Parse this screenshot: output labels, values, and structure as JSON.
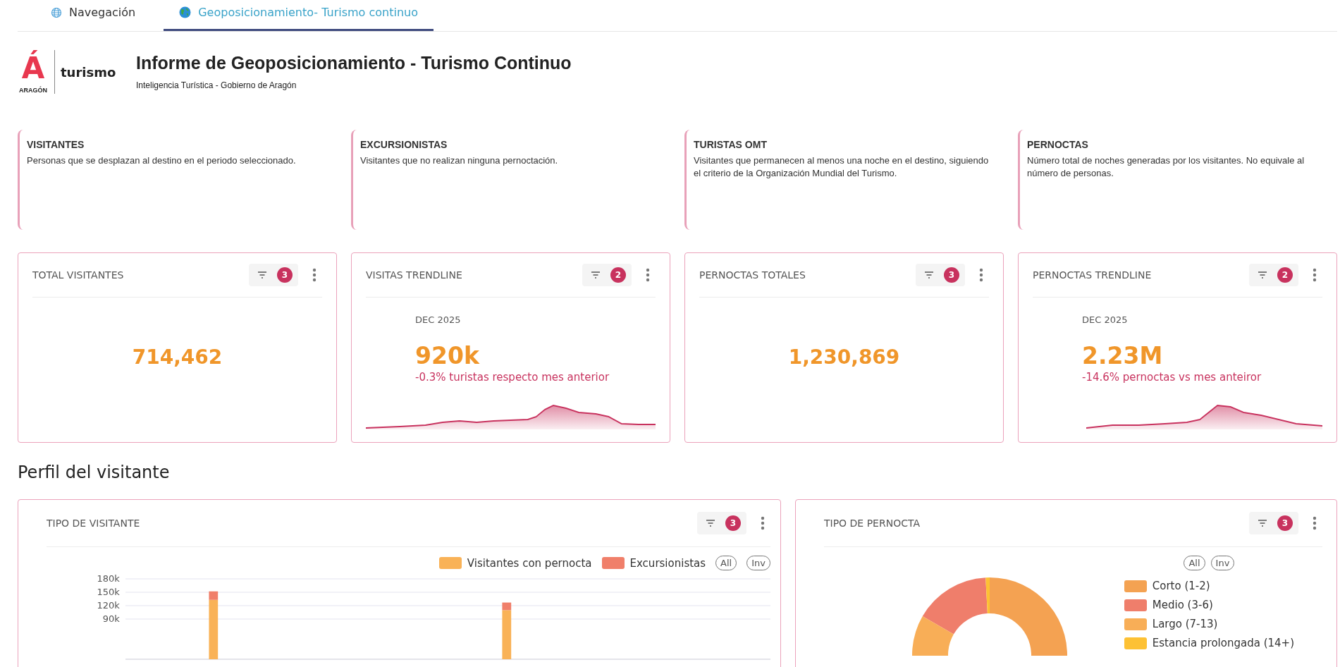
{
  "tabs": [
    {
      "label": "Navegación",
      "selected": false,
      "kind": "globe"
    },
    {
      "label": "Geoposicionamiento- Turismo continuo",
      "selected": true,
      "kind": "earth"
    }
  ],
  "logo": {
    "mark": "Á",
    "region": "ARAGÓN",
    "word": "turismo"
  },
  "header": {
    "title": "Informe de Geoposicionamiento - Turismo Continuo",
    "subtitle": "Inteligencia Turística - Gobierno de Aragón"
  },
  "definitions": [
    {
      "title": "VISITANTES",
      "text": "Personas que se desplazan al destino en el periodo seleccionado."
    },
    {
      "title": "EXCURSIONISTAS",
      "text": "Visitantes que no realizan ninguna pernoctación."
    },
    {
      "title": "TURISTAS OMT",
      "text": "Visitantes que permanecen al menos una noche en el destino, siguiendo el criterio de la Organización Mundial del Turismo."
    },
    {
      "title": "PERNOCTAS",
      "text": "Número total de noches generadas por los visitantes. No equivale al número de personas."
    }
  ],
  "kpis": [
    {
      "kind": "total",
      "title": "TOTAL VISITANTES",
      "filter_count": "3",
      "value": "714,462"
    },
    {
      "kind": "trend",
      "title": "VISITAS TRENDLINE",
      "filter_count": "2",
      "period": "DEC 2025",
      "value": "920k",
      "change": "-0.3% turistas respecto mes anterior"
    },
    {
      "kind": "total",
      "title": "PERNOCTAS TOTALES",
      "filter_count": "3",
      "value": "1,230,869"
    },
    {
      "kind": "trend",
      "title": "PERNOCTAS TRENDLINE",
      "filter_count": "2",
      "period": "DEC 2025",
      "value": "2.23M",
      "change": "-14.6% pernoctas vs mes anteiror"
    }
  ],
  "section_title": "Perfil del visitante",
  "panels": [
    {
      "kind": "bar",
      "title": "TIPO DE VISITANTE",
      "filter_count": "3",
      "toggles": [
        "All",
        "Inv"
      ],
      "chart_data": {
        "type": "bar",
        "stacked": true,
        "grid": true,
        "ylim": [
          0,
          180000
        ],
        "yticks": [
          {
            "value": 90000,
            "label": "90k"
          },
          {
            "value": 120000,
            "label": "120k"
          },
          {
            "value": 150000,
            "label": "150k"
          },
          {
            "value": 180000,
            "label": "180k"
          }
        ],
        "series": [
          {
            "name": "Visitantes con pernocta",
            "color": "#f9b257",
            "values": [
              null,
              133000,
              null,
              null,
              null,
              null,
              110000,
              null,
              null,
              null,
              null
            ]
          },
          {
            "name": "Excursionistas",
            "color": "#f07f6a",
            "values": [
              null,
              19000,
              null,
              null,
              null,
              null,
              17000,
              null,
              null,
              null,
              null
            ]
          }
        ]
      }
    },
    {
      "kind": "donut",
      "title": "TIPO DE PERNOCTA",
      "filter_count": "3",
      "toggles": [
        "All",
        "Inv"
      ],
      "legend": [
        {
          "label": "Corto (1-2)",
          "color": "#f4a252"
        },
        {
          "label": "Medio (3-6)",
          "color": "#ef7e6b"
        },
        {
          "label": "Largo (7-13)",
          "color": "#f8ae57"
        },
        {
          "label": "Estancia prolongada (14+)",
          "color": "#fdc134"
        }
      ]
    }
  ]
}
